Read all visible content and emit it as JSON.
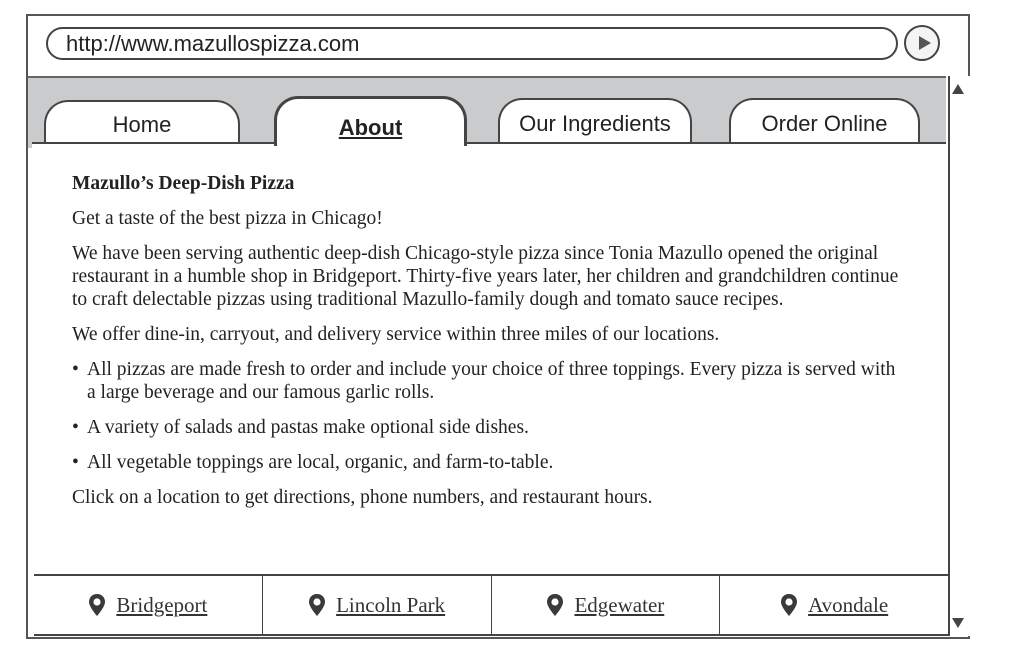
{
  "browser": {
    "url": "http://www.mazullospizza.com"
  },
  "tabs": [
    {
      "label": "Home",
      "active": false
    },
    {
      "label": "About",
      "active": true
    },
    {
      "label": "Our Ingredients",
      "active": false
    },
    {
      "label": "Order Online",
      "active": false
    }
  ],
  "content": {
    "heading": "Mazullo’s Deep-Dish Pizza",
    "tagline": "Get a taste of the best pizza in Chicago!",
    "intro": "We have been serving authentic deep-dish Chicago-style pizza since Tonia Mazullo opened the original restaurant in a humble shop in Bridgeport. Thirty-five years later, her children and grandchildren continue to craft delectable pizzas using traditional Mazullo-family dough and tomato sauce recipes.",
    "services": "We offer dine-in, carryout, and delivery service within three miles of our locations.",
    "bullets": [
      "All pizzas are made fresh to order and include your choice of three toppings. Every pizza is served with a large beverage and our famous garlic rolls.",
      "A variety of salads and pastas make optional side dishes.",
      "All vegetable toppings are local, organic, and farm-to-table."
    ],
    "closing": "Click on a location to get directions, phone numbers, and restaurant hours."
  },
  "locations": [
    {
      "name": "Bridgeport",
      "icon": "map-pin-icon"
    },
    {
      "name": "Lincoln Park",
      "icon": "map-pin-icon"
    },
    {
      "name": "Edgewater",
      "icon": "map-pin-icon"
    },
    {
      "name": "Avondale",
      "icon": "map-pin-icon"
    }
  ],
  "colors": {
    "tabstrip": "#c9cbcd",
    "border": "#444444"
  }
}
